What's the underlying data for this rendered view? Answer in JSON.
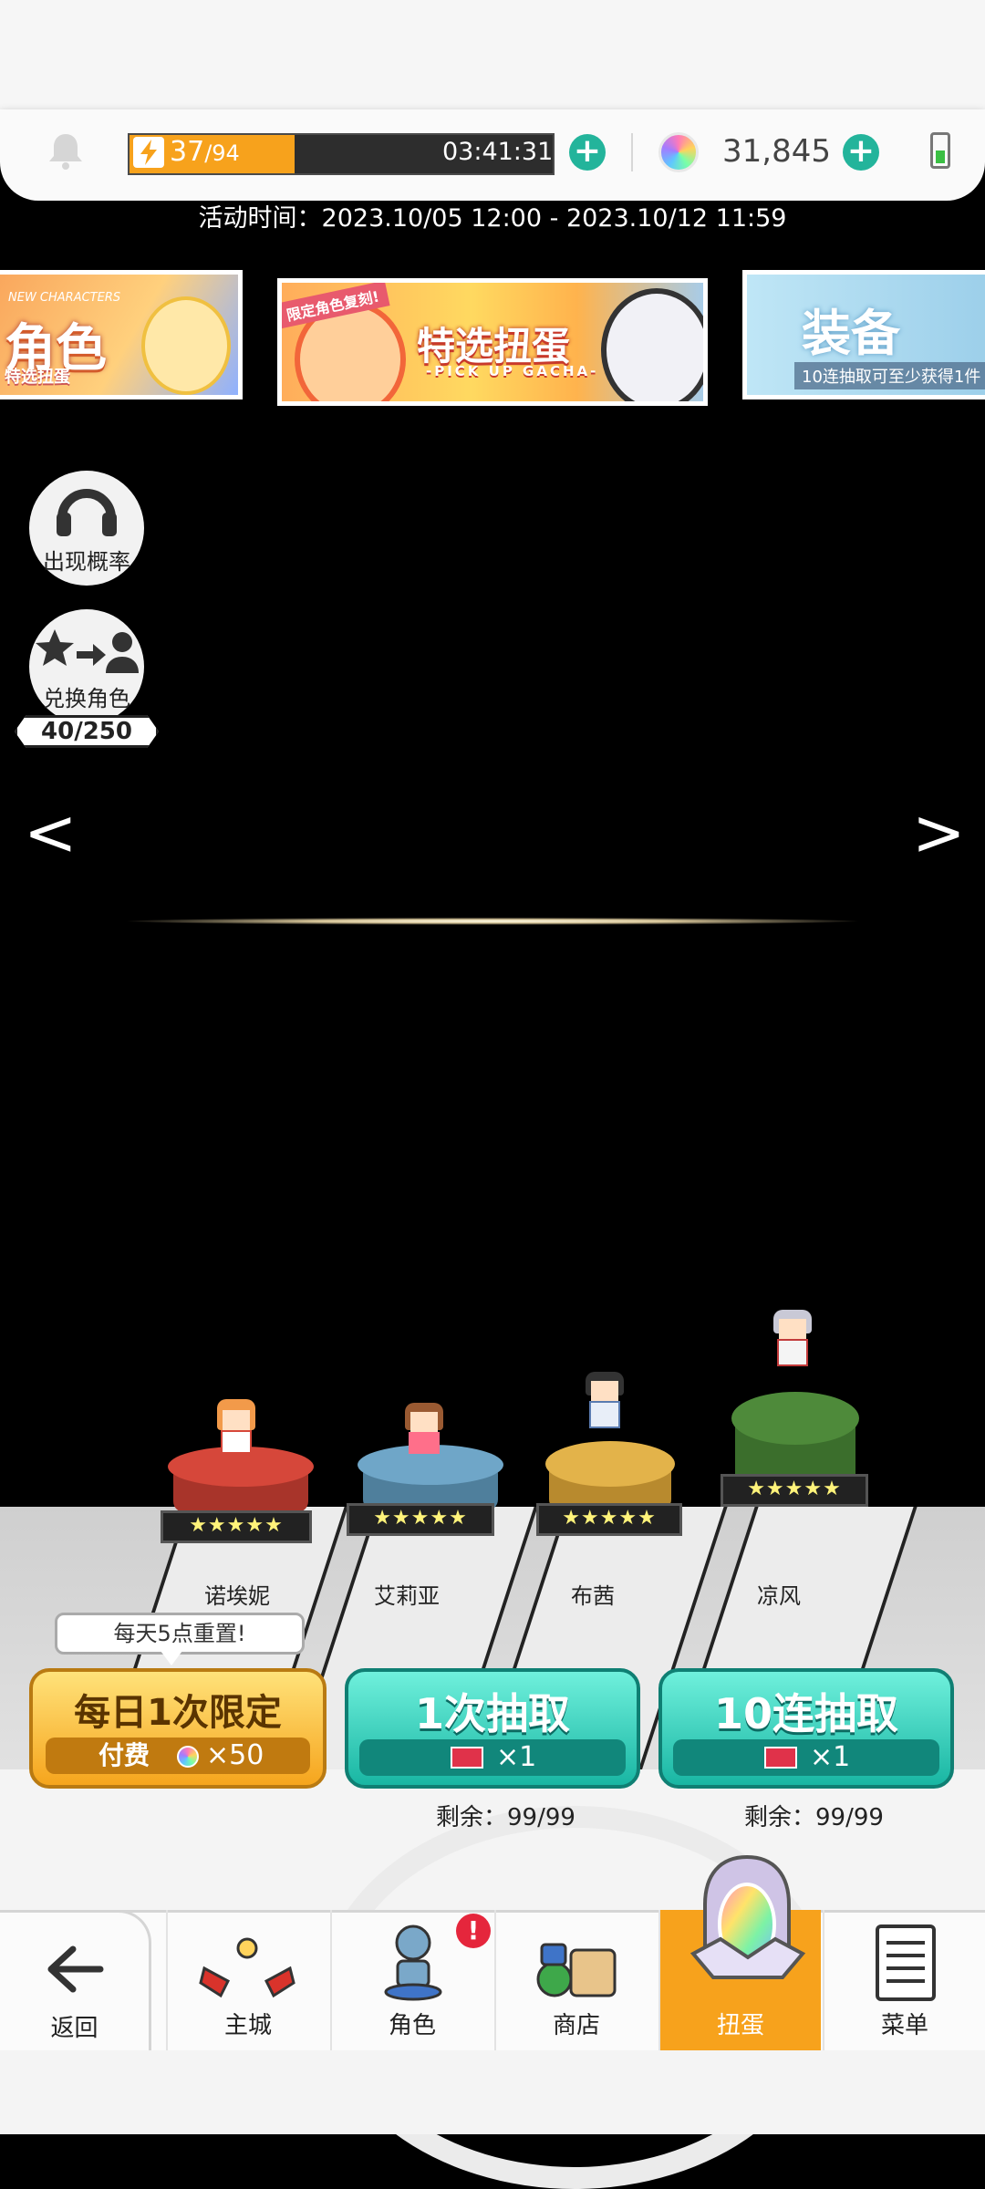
{
  "status": {
    "stamina_current": "37",
    "stamina_max": "/94",
    "stamina_fraction": 0.39,
    "stamina_timer": "03:41:31",
    "gem_count": "31,845"
  },
  "event_time": "活动时间：2023.10/05 12:00 - 2023.10/12 11:59",
  "banners": {
    "left": {
      "small": "NEW CHARACTERS",
      "title": "角色",
      "subtitle": "特选扭蛋"
    },
    "middle": {
      "tag": "限定角色复刻!",
      "title": "特选扭蛋",
      "subtitle": "-PICK UP GACHA-"
    },
    "right": {
      "title": "装备",
      "subtitle": "10连抽取可至少获得1件"
    }
  },
  "side_buttons": {
    "probability_label": "出现概率",
    "exchange_label": "兑换角色",
    "exchange_count": "40/250"
  },
  "nav_arrows": {
    "left": "<",
    "right": ">"
  },
  "characters": [
    {
      "name": "诺埃妮",
      "stars": "★★★★★",
      "color": "#d6473a"
    },
    {
      "name": "艾莉亚",
      "stars": "★★★★★",
      "color": "#6fa6c8"
    },
    {
      "name": "布茜",
      "stars": "★★★★★",
      "color": "#e3b34a"
    },
    {
      "name": "凉风",
      "stars": "★★★★★",
      "color": "#4e8a3a"
    }
  ],
  "tooltip": "每天5点重置!",
  "buttons": {
    "daily": {
      "title": "每日1次限定",
      "cost_label": "付费",
      "cost_value": "×50"
    },
    "single": {
      "title": "1次抽取",
      "cost_value": "×1",
      "remaining": "剩余：99/99"
    },
    "ten": {
      "title": "10连抽取",
      "cost_value": "×1",
      "remaining": "剩余：99/99"
    }
  },
  "nav": {
    "back": "返回",
    "home": "主城",
    "character": "角色",
    "character_badge": "!",
    "shop": "商店",
    "gacha": "扭蛋",
    "menu": "菜单"
  },
  "colors": {
    "accent": "#f7a21c",
    "teal": "#19b6a3"
  }
}
